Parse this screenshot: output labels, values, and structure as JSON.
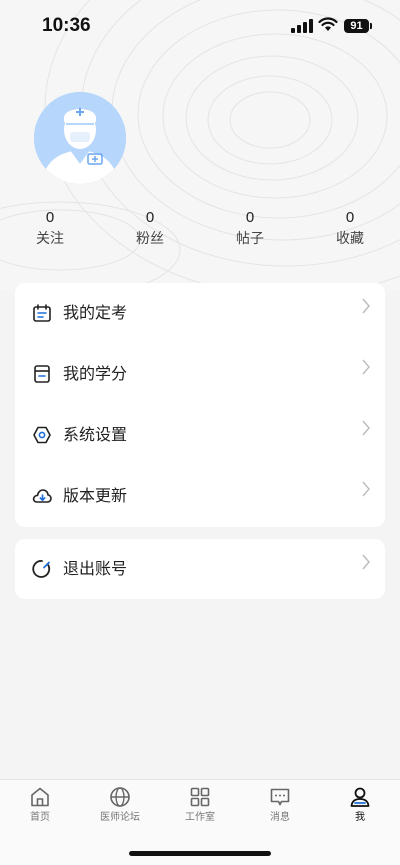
{
  "status_bar": {
    "time": "10:36",
    "battery": "91"
  },
  "profile": {
    "stats": [
      {
        "value": "0",
        "label": "关注"
      },
      {
        "value": "0",
        "label": "粉丝"
      },
      {
        "value": "0",
        "label": "帖子"
      },
      {
        "value": "0",
        "label": "收藏"
      }
    ]
  },
  "menu": {
    "items": [
      {
        "label": "我的定考",
        "icon": "calendar-icon"
      },
      {
        "label": "我的学分",
        "icon": "credit-book-icon"
      },
      {
        "label": "系统设置",
        "icon": "settings-icon"
      },
      {
        "label": "版本更新",
        "icon": "cloud-download-icon"
      }
    ],
    "logout": {
      "label": "退出账号",
      "icon": "logout-icon"
    }
  },
  "tabbar": {
    "items": [
      {
        "label": "首页",
        "icon": "home-icon"
      },
      {
        "label": "医师论坛",
        "icon": "globe-icon"
      },
      {
        "label": "工作室",
        "icon": "grid-icon"
      },
      {
        "label": "消息",
        "icon": "message-icon"
      },
      {
        "label": "我",
        "icon": "person-icon"
      }
    ],
    "active": "我"
  },
  "colors": {
    "accent": "#1e6fd9",
    "avatar_bg": "#b7d6fb"
  }
}
